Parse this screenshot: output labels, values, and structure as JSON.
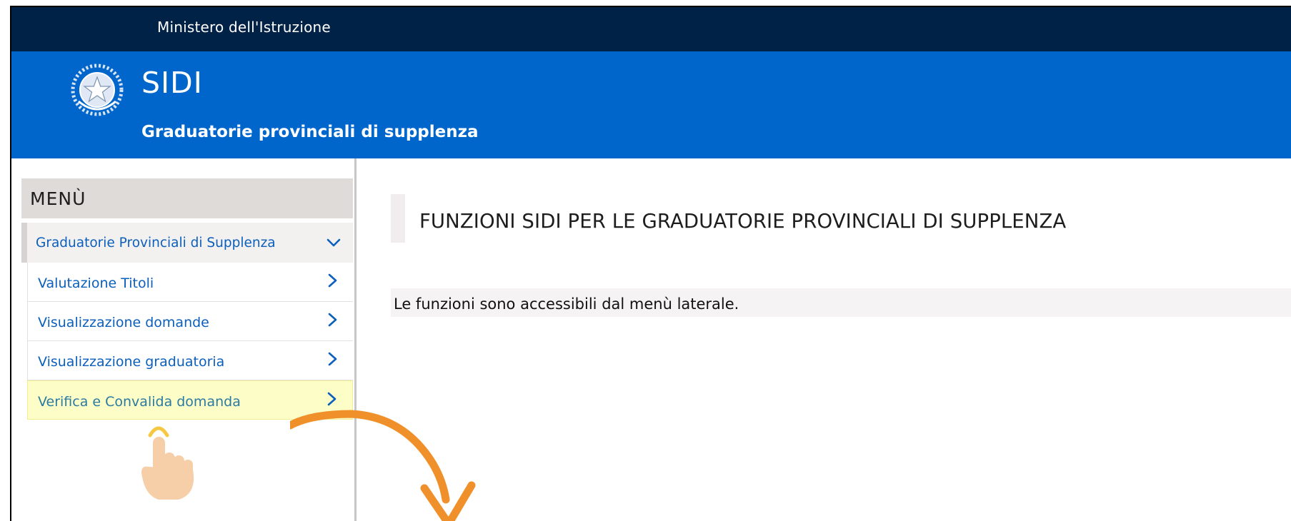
{
  "topbar": {
    "ministry": "Ministero dell'Istruzione"
  },
  "header": {
    "title": "SIDI",
    "subtitle": "Graduatorie provinciali di supplenza",
    "emblem_icon": "italian-republic-emblem"
  },
  "sidebar": {
    "menu_title": "MENÙ",
    "group": {
      "label": "Graduatorie Provinciali di Supplenza",
      "icon": "chevron-down-icon",
      "expanded": true
    },
    "items": [
      {
        "label": "Valutazione Titoli",
        "icon": "chevron-right-icon"
      },
      {
        "label": "Visualizzazione domande",
        "icon": "chevron-right-icon"
      },
      {
        "label": "Visualizzazione graduatoria",
        "icon": "chevron-right-icon"
      },
      {
        "label": "Verifica e Convalida domanda",
        "icon": "chevron-right-icon",
        "highlighted": true
      }
    ]
  },
  "main": {
    "title": "FUNZIONI SIDI PER LE GRADUATORIE PROVINCIALI DI SUPPLENZA",
    "info": "Le funzioni sono accessibili dal menù laterale."
  },
  "annotations": {
    "pointer_icon": "tap-finger-icon",
    "arrow_icon": "curved-arrow-icon",
    "arrow_color": "#f0902a"
  },
  "colors": {
    "topbar": "#002246",
    "header": "#0066cc",
    "link": "#0b5fbd",
    "highlight": "#fdfdc7"
  }
}
